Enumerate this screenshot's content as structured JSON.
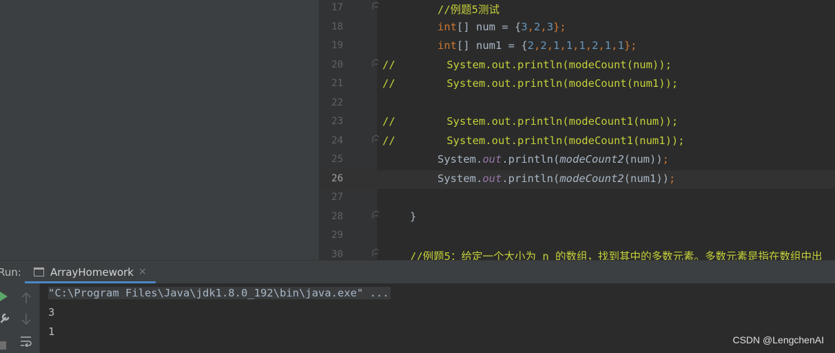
{
  "editor": {
    "lines": [
      {
        "num": "17",
        "current": false,
        "fold": true,
        "indent": 88,
        "tokens": [
          {
            "t": "//例题5测试",
            "c": "comment"
          }
        ]
      },
      {
        "num": "18",
        "current": false,
        "fold": false,
        "indent": 88,
        "tokens": [
          {
            "t": "int",
            "c": "kw"
          },
          {
            "t": "[] num = {",
            "c": "norm"
          },
          {
            "t": "3",
            "c": "num"
          },
          {
            "t": ",",
            "c": "semi"
          },
          {
            "t": "2",
            "c": "num"
          },
          {
            "t": ",",
            "c": "semi"
          },
          {
            "t": "3",
            "c": "num"
          },
          {
            "t": "};",
            "c": "semi"
          }
        ]
      },
      {
        "num": "19",
        "current": false,
        "fold": false,
        "indent": 88,
        "tokens": [
          {
            "t": "int",
            "c": "kw"
          },
          {
            "t": "[] num1 = {",
            "c": "norm"
          },
          {
            "t": "2",
            "c": "num"
          },
          {
            "t": ",",
            "c": "semi"
          },
          {
            "t": "2",
            "c": "num"
          },
          {
            "t": ",",
            "c": "semi"
          },
          {
            "t": "1",
            "c": "num"
          },
          {
            "t": ",",
            "c": "semi"
          },
          {
            "t": "1",
            "c": "num"
          },
          {
            "t": ",",
            "c": "semi"
          },
          {
            "t": "1",
            "c": "num"
          },
          {
            "t": ",",
            "c": "semi"
          },
          {
            "t": "2",
            "c": "num"
          },
          {
            "t": ",",
            "c": "semi"
          },
          {
            "t": "1",
            "c": "num"
          },
          {
            "t": ",",
            "c": "semi"
          },
          {
            "t": "1",
            "c": "num"
          },
          {
            "t": "};",
            "c": "semi"
          }
        ]
      },
      {
        "num": "20",
        "current": false,
        "fold": true,
        "indent": 8,
        "tokens": [
          {
            "t": "//        System.out.println(modeCount(num));",
            "c": "comment"
          }
        ]
      },
      {
        "num": "21",
        "current": false,
        "fold": false,
        "indent": 8,
        "tokens": [
          {
            "t": "//        System.out.println(modeCount(num1));",
            "c": "comment"
          }
        ]
      },
      {
        "num": "22",
        "current": false,
        "fold": false,
        "indent": 8,
        "tokens": []
      },
      {
        "num": "23",
        "current": false,
        "fold": false,
        "indent": 8,
        "tokens": [
          {
            "t": "//        System.out.println(modeCount1(num));",
            "c": "comment"
          }
        ]
      },
      {
        "num": "24",
        "current": false,
        "fold": true,
        "indent": 8,
        "tokens": [
          {
            "t": "//        System.out.println(modeCount1(num1));",
            "c": "comment"
          }
        ]
      },
      {
        "num": "25",
        "current": false,
        "fold": false,
        "indent": 88,
        "tokens": [
          {
            "t": "System.",
            "c": "norm"
          },
          {
            "t": "out",
            "c": "field"
          },
          {
            "t": ".println(",
            "c": "norm"
          },
          {
            "t": "modeCount2",
            "c": "static"
          },
          {
            "t": "(num))",
            "c": "norm"
          },
          {
            "t": ";",
            "c": "semi"
          }
        ]
      },
      {
        "num": "26",
        "current": true,
        "fold": false,
        "indent": 88,
        "tokens": [
          {
            "t": "System.",
            "c": "norm"
          },
          {
            "t": "out",
            "c": "field"
          },
          {
            "t": ".println(",
            "c": "norm"
          },
          {
            "t": "modeCount2",
            "c": "static"
          },
          {
            "t": "(num1))",
            "c": "norm"
          },
          {
            "t": ";",
            "c": "semi"
          }
        ]
      },
      {
        "num": "27",
        "current": false,
        "fold": false,
        "indent": 88,
        "tokens": []
      },
      {
        "num": "28",
        "current": false,
        "fold": true,
        "indent": 48,
        "tokens": [
          {
            "t": "}",
            "c": "norm"
          }
        ]
      },
      {
        "num": "29",
        "current": false,
        "fold": false,
        "indent": 48,
        "tokens": []
      },
      {
        "num": "30",
        "current": false,
        "fold": true,
        "indent": 48,
        "tokens": [
          {
            "t": "//例题5：给定一个大小为 n 的数组，找到其中的多数元素。多数元素是指在数组中出",
            "c": "comment"
          }
        ]
      }
    ]
  },
  "run_panel": {
    "label": "Run:",
    "tab_label": "ArrayHomework",
    "tab_close": "×"
  },
  "console": {
    "lines": [
      "\"C:\\Program Files\\Java\\jdk1.8.0_192\\bin\\java.exe\" ...",
      "3",
      "1"
    ]
  },
  "watermark": "CSDN @LengchenAI",
  "colors": {
    "comment": "#c5d13a",
    "keyword": "#cc7832",
    "number": "#6897bb",
    "field": "#9876aa",
    "text": "#a9b7c6",
    "accent": "#4a88c7",
    "run_green": "#59a869"
  },
  "icons": {
    "run": "run-play-icon",
    "settings": "wrench-icon",
    "stop": "stop-icon",
    "up": "arrow-up-icon",
    "down": "arrow-down-icon",
    "wrap": "soft-wrap-icon",
    "tab": "window-icon"
  }
}
